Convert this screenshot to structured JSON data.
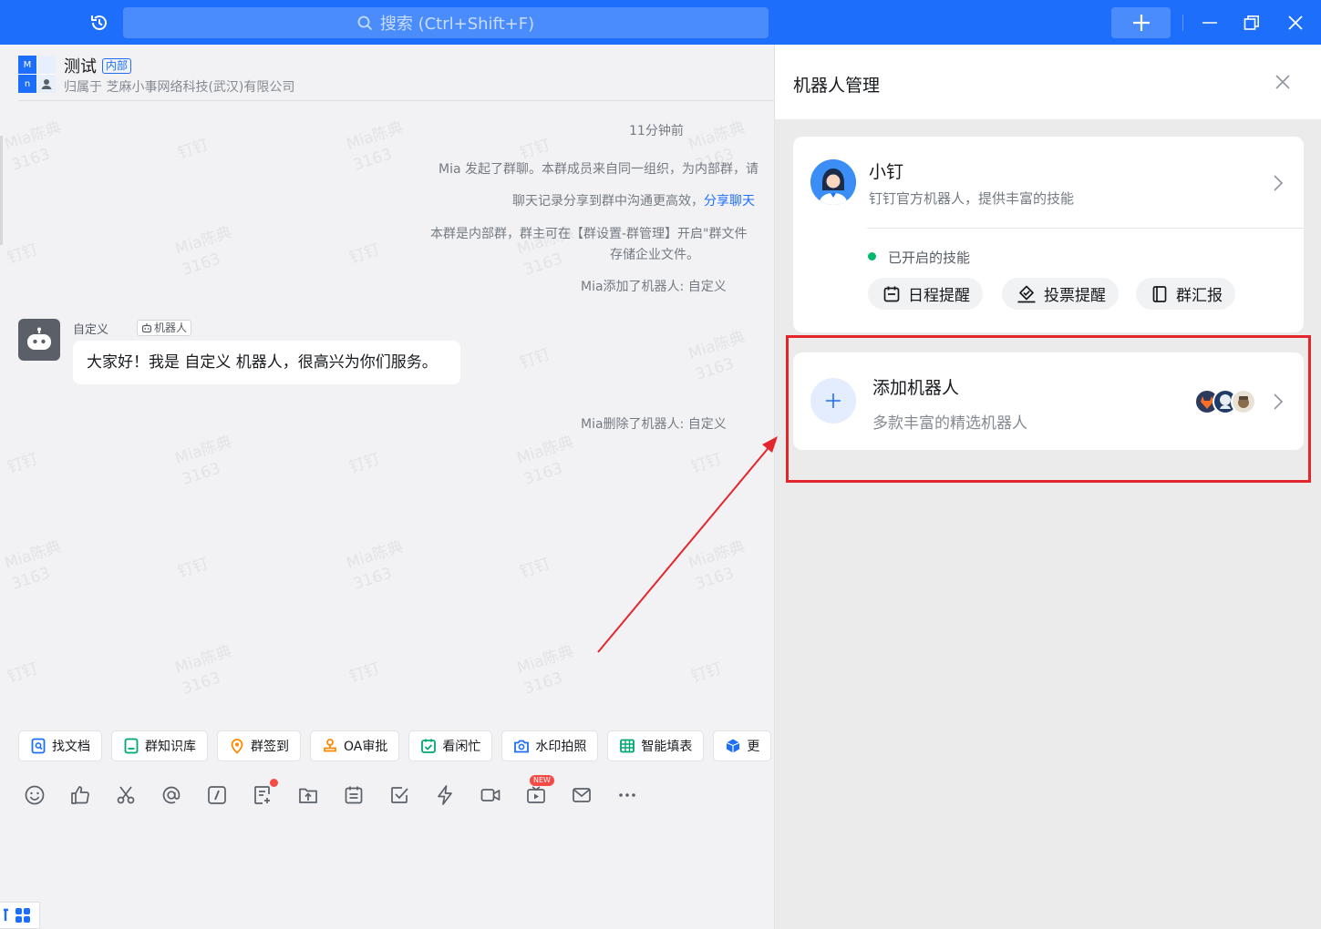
{
  "topbar": {
    "search_placeholder": "搜索 (Ctrl+Shift+F)"
  },
  "group": {
    "title": "测试",
    "tag": "内部",
    "subtitle": "归属于 芝麻小事网络科技(武汉)有限公司",
    "avatar_letters": [
      "M",
      "n"
    ]
  },
  "watermark": {
    "name": "Mia陈典",
    "id": "3163",
    "brand": "钉钉"
  },
  "messages": {
    "time": "11分钟前",
    "sys1": "Mia 发起了群聊。本群成员来自同一组织，为内部群，请",
    "sys2_text": "聊天记录分享到群中沟通更高效，",
    "sys2_link": "分享聊天",
    "sys3_line1": "本群是内部群，群主可在【群设置-群管理】开启\"群文件",
    "sys3_line2": "存储企业文件。",
    "sys_added": "Mia添加了机器人: 自定义",
    "bot_name": "自定义",
    "bot_tag": "机器人",
    "bot_message": "大家好！我是 自定义 机器人，很高兴为你们服务。",
    "sys_removed": "Mia删除了机器人: 自定义"
  },
  "quick_actions": [
    {
      "label": "找文档",
      "color": "#1d6ffb"
    },
    {
      "label": "群知识库",
      "color": "#00a870"
    },
    {
      "label": "群签到",
      "color": "#ff8800"
    },
    {
      "label": "OA审批",
      "color": "#ff8800"
    },
    {
      "label": "看闲忙",
      "color": "#00a870"
    },
    {
      "label": "水印拍照",
      "color": "#1d6ffb"
    },
    {
      "label": "智能填表",
      "color": "#00a870"
    },
    {
      "label": "更",
      "color": "#1d6ffb"
    }
  ],
  "toolbar": {
    "new_badge": "NEW",
    "icons": [
      "emoji-icon",
      "thumbs-up-icon",
      "scissors-icon",
      "at-icon",
      "slash-command-icon",
      "doc-add-icon",
      "folder-upload-icon",
      "calendar-icon",
      "todo-check-icon",
      "lightning-icon",
      "video-call-icon",
      "live-icon",
      "mail-icon",
      "more-icon"
    ]
  },
  "panel": {
    "title": "机器人管理",
    "xiaoding": {
      "name": "小钉",
      "desc": "钉钉官方机器人，提供丰富的技能",
      "skills_label": "已开启的技能",
      "skills": [
        "日程提醒",
        "投票提醒",
        "群汇报"
      ]
    },
    "add_robot": {
      "title": "添加机器人",
      "subtitle": "多款丰富的精选机器人"
    }
  },
  "colors": {
    "brand": "#1d6ffb",
    "highlight": "#e3262c",
    "status_on": "#00b96b"
  }
}
